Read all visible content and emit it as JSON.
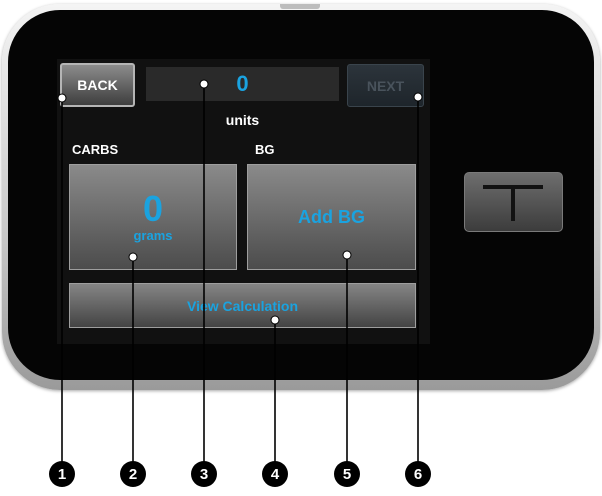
{
  "screen": {
    "back_label": "BACK",
    "next_label": "NEXT",
    "units_value": "0",
    "units_label": "units",
    "carbs_label": "CARBS",
    "bg_label": "BG",
    "carbs_value": "0",
    "carbs_unit": "grams",
    "bg_button_label": "Add BG",
    "view_calculation_label": "View Calculation"
  },
  "callouts": [
    "1",
    "2",
    "3",
    "4",
    "5",
    "6"
  ],
  "colors": {
    "accent": "#1aa3e0",
    "screen_bg": "#111111",
    "next_disabled_text": "#49535c"
  },
  "icons": {
    "device_button": "t-logo-icon"
  }
}
